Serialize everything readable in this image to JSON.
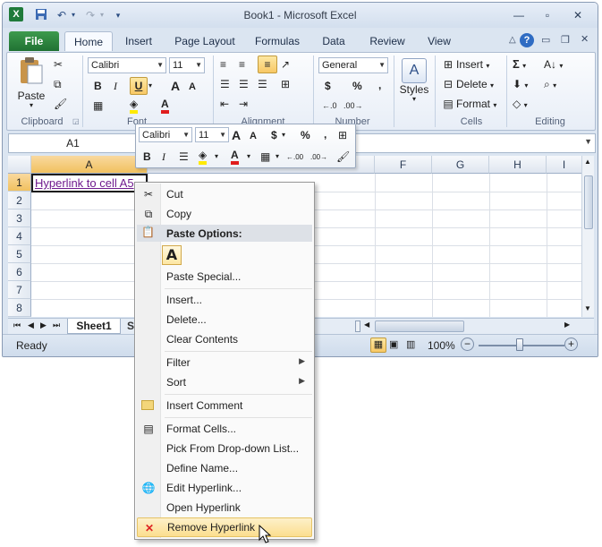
{
  "window": {
    "title": "Book1  -  Microsoft Excel",
    "qat": {
      "save_icon": "save-icon",
      "undo_icon": "undo-icon",
      "redo_icon": "redo-icon"
    }
  },
  "ribbon": {
    "tabs": [
      "File",
      "Home",
      "Insert",
      "Page Layout",
      "Formulas",
      "Data",
      "Review",
      "View"
    ],
    "active_tab": "Home",
    "clipboard": {
      "paste_label": "Paste",
      "group_label": "Clipboard"
    },
    "font": {
      "family": "Calibri",
      "size": "11",
      "bold": "B",
      "italic": "I",
      "underline": "U",
      "grow": "A",
      "shrink": "A",
      "color_letter": "A",
      "group_label": "Font"
    },
    "alignment": {
      "group_label": "Alignment"
    },
    "number": {
      "format": "General",
      "currency": "$",
      "percent": "%",
      "comma": ",",
      "group_label": "Number"
    },
    "styles": {
      "label": "Styles"
    },
    "cells": {
      "insert": "Insert",
      "delete": "Delete",
      "format": "Format",
      "group_label": "Cells"
    },
    "editing": {
      "sum": "Σ",
      "group_label": "Editing"
    }
  },
  "formula_bar": {
    "name_box": "A1"
  },
  "mini_toolbar": {
    "font": "Calibri",
    "size": "11",
    "grow": "A",
    "shrink": "A",
    "currency": "$",
    "percent": "%",
    "comma": ",",
    "bold": "B",
    "italic": "I",
    "color_letter": "A",
    "decrease_decimal": "←.00",
    "increase_decimal": ".00→"
  },
  "grid": {
    "columns": [
      "A",
      "F",
      "G",
      "H",
      "I"
    ],
    "rows": [
      "1",
      "2",
      "3",
      "4",
      "5",
      "6",
      "7",
      "8"
    ],
    "cell_a1": "Hyperlink to cell A5"
  },
  "sheet_tabs": {
    "sheet1": "Sheet1",
    "partial": "S"
  },
  "status": {
    "ready": "Ready",
    "zoom": "100%",
    "zoom_level": 100,
    "minus": "−",
    "plus": "+"
  },
  "context_menu": {
    "cut": "Cut",
    "copy": "Copy",
    "paste_options_header": "Paste Options:",
    "paste_option_a": "A",
    "paste_special": "Paste Special...",
    "insert": "Insert...",
    "delete": "Delete...",
    "clear_contents": "Clear Contents",
    "filter": "Filter",
    "sort": "Sort",
    "insert_comment": "Insert Comment",
    "format_cells": "Format Cells...",
    "pick_list": "Pick From Drop-down List...",
    "define_name": "Define Name...",
    "edit_hyperlink": "Edit Hyperlink...",
    "open_hyperlink": "Open Hyperlink",
    "remove_hyperlink": "Remove Hyperlink"
  }
}
